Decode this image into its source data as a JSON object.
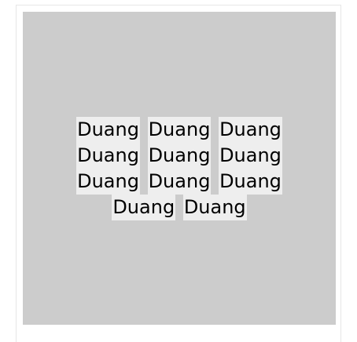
{
  "words": [
    "Duang",
    "Duang",
    "Duang",
    "Duang",
    "Duang",
    "Duang",
    "Duang",
    "Duang",
    "Duang",
    "Duang",
    "Duang"
  ],
  "colors": {
    "background": "#ffffff",
    "panel": "#cccccc",
    "chip": "#eeeeee",
    "text": "#000000"
  }
}
